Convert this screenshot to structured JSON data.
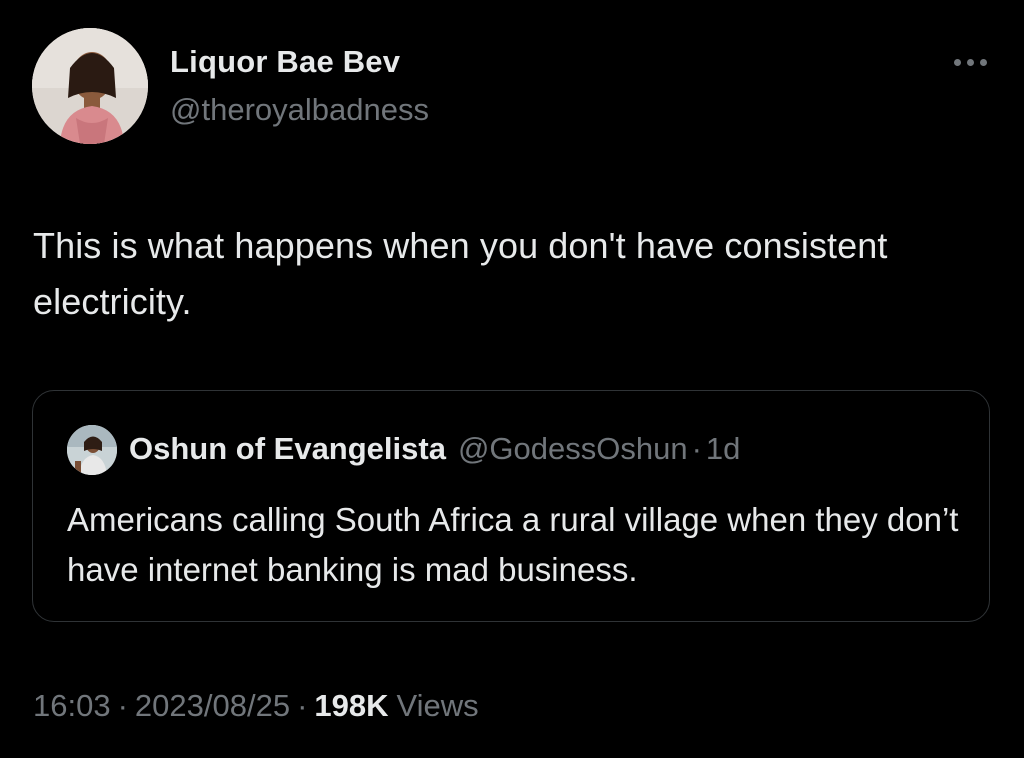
{
  "author": {
    "name": "Liquor Bae Bev",
    "handle": "@theroyalbadness",
    "avatar_icon": "profile-photo"
  },
  "more_icon": "more-horizontal-icon",
  "tweet": {
    "text": "This is what happens when you don't have consistent electricity."
  },
  "quote": {
    "name": "Oshun of Evangelista",
    "handle": "@GodessOshun",
    "separator": "·",
    "time": "1d",
    "text": "Americans calling South Africa a rural village when they don’t have internet banking is mad business.",
    "avatar_icon": "profile-photo"
  },
  "meta": {
    "time": "16:03",
    "separator": "·",
    "date": "2023/08/25",
    "views_count": "198K",
    "views_label": "Views"
  },
  "colors": {
    "background": "#000000",
    "primary_text": "#e7e9ea",
    "secondary_text": "#71767b",
    "border": "#2f3336"
  }
}
